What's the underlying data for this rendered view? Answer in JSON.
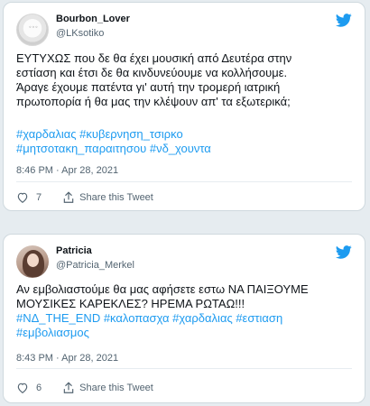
{
  "tweets": [
    {
      "author_name": "Bourbon_Lover",
      "author_handle": "@LKsotiko",
      "avatar_icon": "bourbon-logo-avatar",
      "text_lines": [
        "ΕΥΤΥΧΩΣ που δε θα έχει μουσική από Δευτέρα στην",
        "εστίαση και έτσι δε θα κινδυνεύουμε να κολλήσουμε.",
        "Άραγε έχουμε πατέντα γι' αυτή την τρομερή ιατρική",
        "πρωτοπορία ή θα μας την κλέψουν απ' τα εξωτερικά;"
      ],
      "hashtag_lines": [
        "#χαρδαλιας #κυβερνηση_τσιρκο",
        "#μητσοτακη_παραιτησου #νδ_χουντα"
      ],
      "timestamp": "8:46 PM · Apr 28, 2021",
      "likes": "7",
      "share_label": "Share this Tweet",
      "bird_color": "#1d9bf0"
    },
    {
      "author_name": "Patricia",
      "author_handle": "@Patricia_Merkel",
      "avatar_icon": "profile-photo-avatar",
      "text_lines": [
        "Αν εμβολιαστούμε θα μας αφήσετε εστω ΝΑ ΠΑΙΞΟΥΜΕ",
        "ΜΟΥΣΙΚΕΣ ΚΑΡΕΚΛΕΣ? ΗΡΕΜΑ ΡΩΤΑΩ!!!"
      ],
      "hashtag_lines": [
        "#ΝΔ_THE_END #καλοπασχα #χαρδαλιας #εστιαση",
        "#εμβολιασμος"
      ],
      "timestamp": "8:43 PM · Apr 28, 2021",
      "likes": "6",
      "share_label": "Share this Tweet",
      "bird_color": "#1d9bf0"
    }
  ]
}
